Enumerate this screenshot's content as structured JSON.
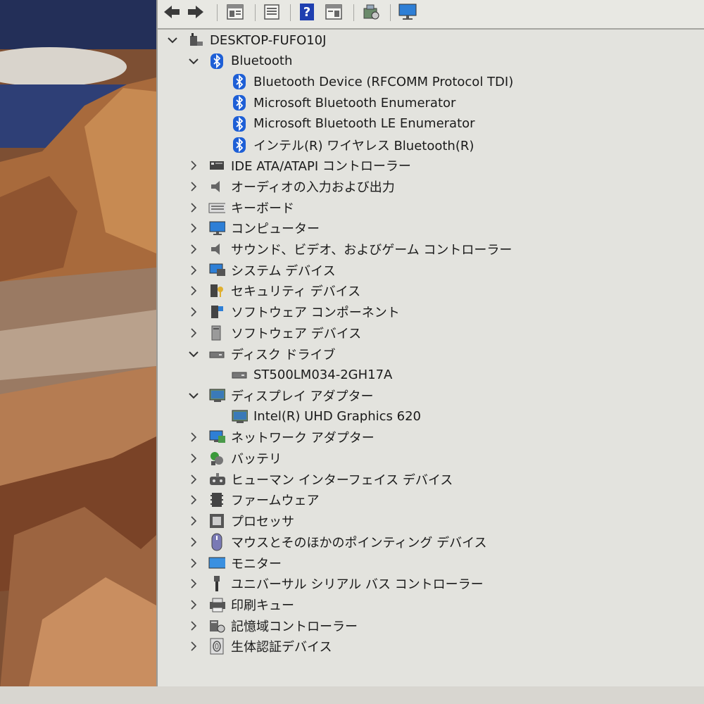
{
  "toolbar": {
    "buttons": [
      "back-icon",
      "forward-icon",
      "properties-icon",
      "update-driver-icon",
      "help-icon",
      "view-icon",
      "scan-hardware-icon",
      "monitor-icon"
    ]
  },
  "tree": {
    "root": "DESKTOP-FUFO10J",
    "bluetooth": {
      "label": "Bluetooth",
      "children": [
        "Bluetooth Device (RFCOMM Protocol TDI)",
        "Microsoft Bluetooth Enumerator",
        "Microsoft Bluetooth LE Enumerator",
        "インテル(R) ワイヤレス Bluetooth(R)"
      ]
    },
    "categories": [
      "IDE ATA/ATAPI コントローラー",
      "オーディオの入力および出力",
      "キーボード",
      "コンピューター",
      "サウンド、ビデオ、およびゲーム コントローラー",
      "システム デバイス",
      "セキュリティ デバイス",
      "ソフトウェア コンポーネント",
      "ソフトウェア デバイス"
    ],
    "disk": {
      "label": "ディスク ドライブ",
      "children": [
        "ST500LM034-2GH17A"
      ]
    },
    "display": {
      "label": "ディスプレイ アダプター",
      "children": [
        "Intel(R) UHD Graphics 620"
      ]
    },
    "categories2": [
      "ネットワーク アダプター",
      "バッテリ",
      "ヒューマン インターフェイス デバイス",
      "ファームウェア",
      "プロセッサ",
      "マウスとそのほかのポインティング デバイス",
      "モニター",
      "ユニバーサル シリアル バス コントローラー",
      "印刷キュー",
      "記憶域コントローラー",
      "生体認証デバイス"
    ]
  },
  "colors": {
    "bluetooth": "#1e5fd6",
    "window_bg": "#e3e3de",
    "text": "#1a1a1a"
  }
}
